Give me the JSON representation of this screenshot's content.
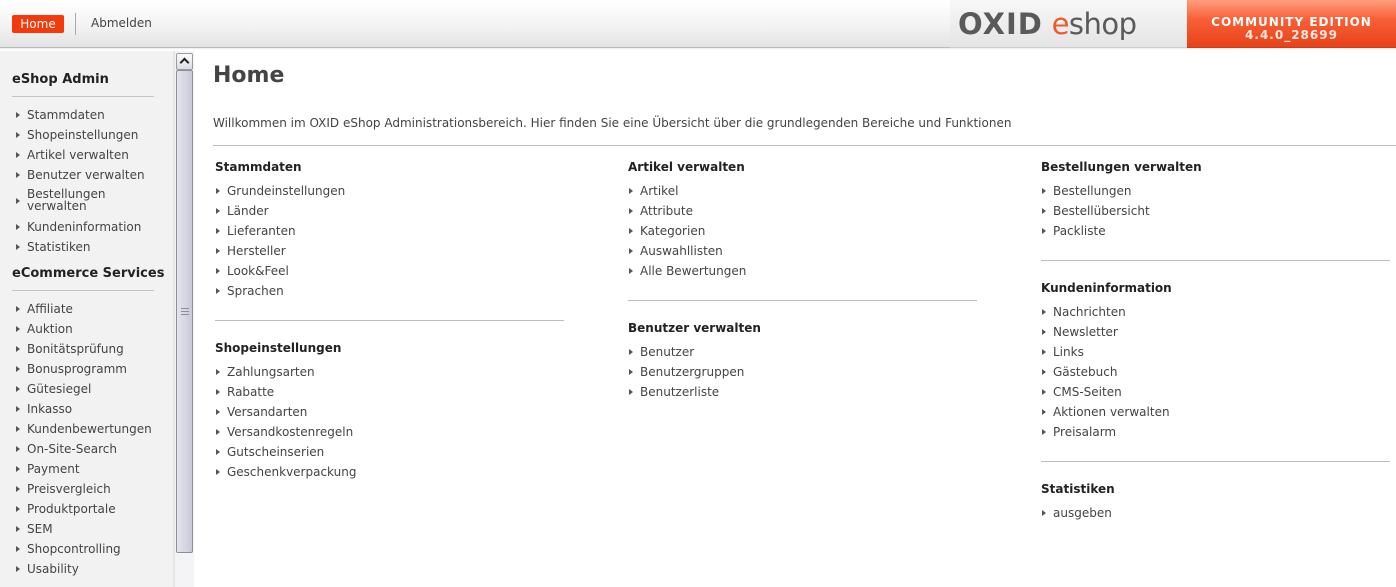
{
  "header": {
    "home_label": "Home",
    "logout_label": "Abmelden",
    "logo_oxid": "OXID",
    "logo_e": "e",
    "logo_shop": "shop",
    "edition": "COMMUNITY EDITION",
    "version": "4.4.0_28699",
    "accent_color": "#f23a0c"
  },
  "sidebar": {
    "sections": [
      {
        "title": "eShop Admin",
        "items": [
          {
            "label": "Stammdaten"
          },
          {
            "label": "Shopeinstellungen"
          },
          {
            "label": "Artikel verwalten"
          },
          {
            "label": "Benutzer verwalten"
          },
          {
            "label": "Bestellungen verwalten"
          },
          {
            "label": "Kundeninformation"
          },
          {
            "label": "Statistiken"
          }
        ]
      },
      {
        "title": "eCommerce Services",
        "items": [
          {
            "label": "Affiliate"
          },
          {
            "label": "Auktion"
          },
          {
            "label": "Bonitätsprüfung"
          },
          {
            "label": "Bonusprogramm"
          },
          {
            "label": "Gütesiegel"
          },
          {
            "label": "Inkasso"
          },
          {
            "label": "Kundenbewertungen"
          },
          {
            "label": "On-Site-Search"
          },
          {
            "label": "Payment"
          },
          {
            "label": "Preisvergleich"
          },
          {
            "label": "Produktportale"
          },
          {
            "label": "SEM"
          },
          {
            "label": "Shopcontrolling"
          },
          {
            "label": "Usability"
          }
        ]
      }
    ]
  },
  "main": {
    "title": "Home",
    "welcome": "Willkommen im OXID eShop Administrationsbereich. Hier finden Sie eine Übersicht über die grundlegenden Bereiche und Funktionen",
    "columns": [
      [
        {
          "title": "Stammdaten",
          "items": [
            "Grundeinstellungen",
            "Länder",
            "Lieferanten",
            "Hersteller",
            "Look&Feel",
            "Sprachen"
          ]
        },
        {
          "title": "Shopeinstellungen",
          "items": [
            "Zahlungsarten",
            "Rabatte",
            "Versandarten",
            "Versandkostenregeln",
            "Gutscheinserien",
            "Geschenkverpackung"
          ]
        }
      ],
      [
        {
          "title": "Artikel verwalten",
          "items": [
            "Artikel",
            "Attribute",
            "Kategorien",
            "Auswahllisten",
            "Alle Bewertungen"
          ]
        },
        {
          "title": "Benutzer verwalten",
          "items": [
            "Benutzer",
            "Benutzergruppen",
            "Benutzerliste"
          ]
        }
      ],
      [
        {
          "title": "Bestellungen verwalten",
          "items": [
            "Bestellungen",
            "Bestellübersicht",
            "Packliste"
          ]
        },
        {
          "title": "Kundeninformation",
          "items": [
            "Nachrichten",
            "Newsletter",
            "Links",
            "Gästebuch",
            "CMS-Seiten",
            "Aktionen verwalten",
            "Preisalarm"
          ]
        },
        {
          "title": "Statistiken",
          "items": [
            "ausgeben"
          ]
        }
      ]
    ]
  }
}
